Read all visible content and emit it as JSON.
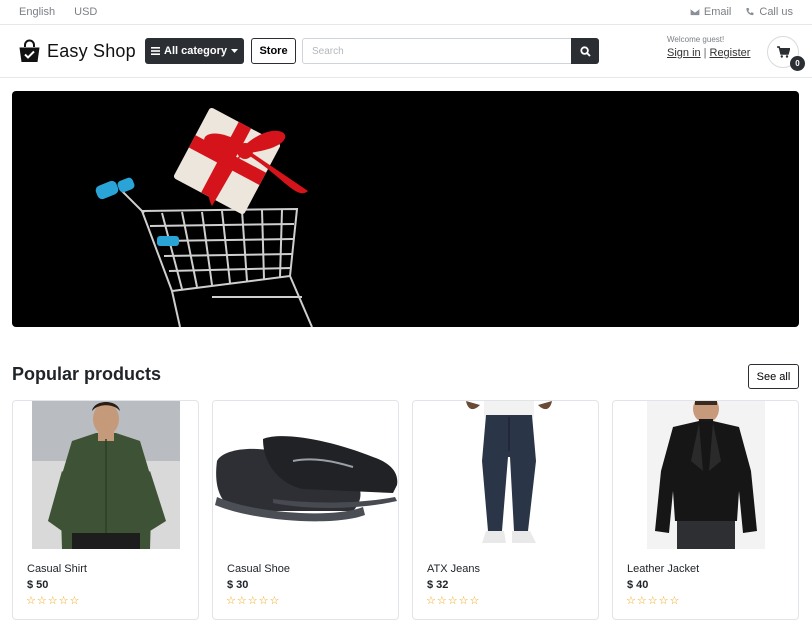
{
  "topbar": {
    "language": "English",
    "currency": "USD",
    "email_label": "Email",
    "call_label": "Call us"
  },
  "header": {
    "logo_text": "Easy Shop",
    "category_button": "All category",
    "store_button": "Store",
    "search_placeholder": "Search",
    "welcome": "Welcome guest!",
    "sign_in": "Sign in",
    "register": "Register",
    "cart_count": "0"
  },
  "section": {
    "title": "Popular products",
    "see_all": "See all"
  },
  "products": [
    {
      "name": "Casual Shirt",
      "price": "$ 50",
      "rating": 0
    },
    {
      "name": "Casual Shoe",
      "price": "$ 30",
      "rating": 0
    },
    {
      "name": "ATX Jeans",
      "price": "$ 32",
      "rating": 0
    },
    {
      "name": "Leather Jacket",
      "price": "$ 40",
      "rating": 0
    }
  ],
  "colors": {
    "dark": "#2b2f33",
    "star": "#f0a30a",
    "banner_bg": "#000000",
    "gift_ribbon": "#d4141a",
    "cart_handle": "#2aa3d6"
  },
  "icons": [
    "envelope-icon",
    "phone-icon",
    "shopping-bag-icon",
    "bars-icon",
    "caret-down-icon",
    "search-icon",
    "cart-icon",
    "star-outline-icon"
  ]
}
